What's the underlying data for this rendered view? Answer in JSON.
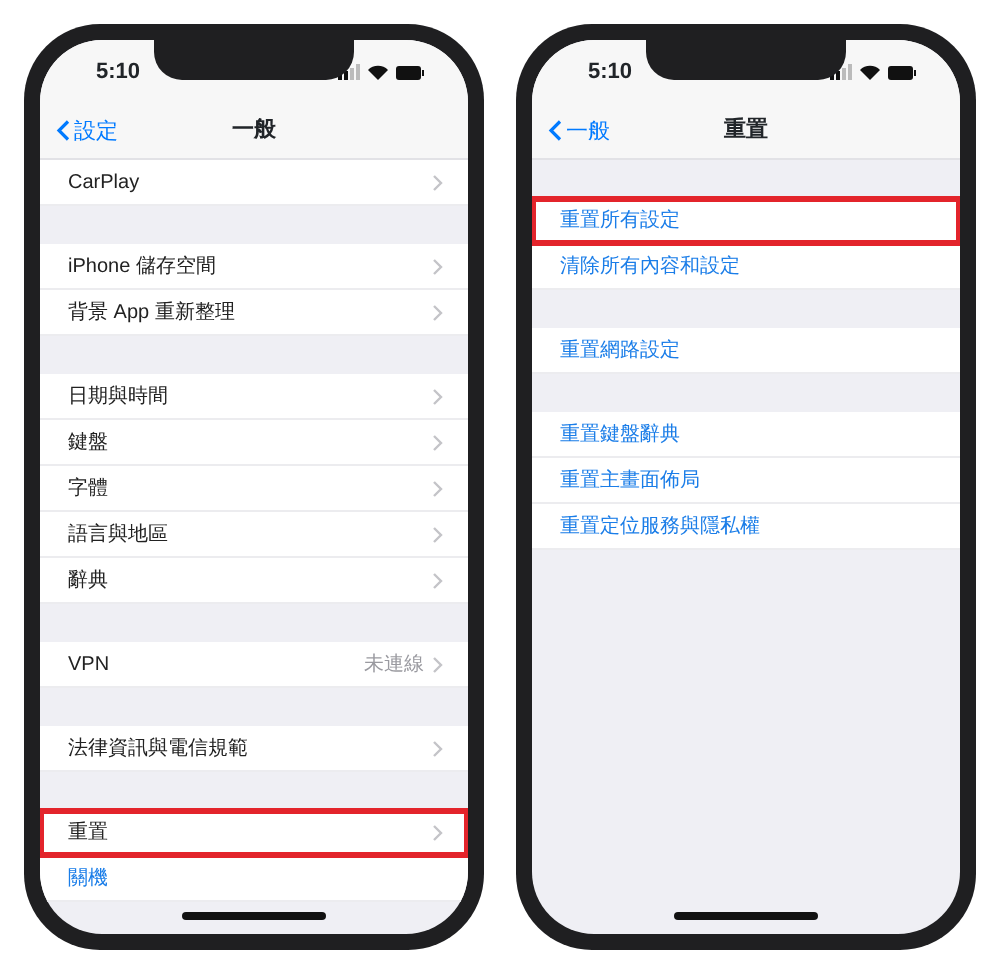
{
  "phones": [
    {
      "time": "5:10",
      "back": "設定",
      "title": "一般",
      "groups": [
        [
          {
            "label": "CarPlay",
            "kind": "nav",
            "highlighted": false
          }
        ],
        [
          {
            "label": "iPhone 儲存空間",
            "kind": "nav",
            "highlighted": false
          },
          {
            "label": "背景 App 重新整理",
            "kind": "nav",
            "highlighted": false
          }
        ],
        [
          {
            "label": "日期與時間",
            "kind": "nav",
            "highlighted": false
          },
          {
            "label": "鍵盤",
            "kind": "nav",
            "highlighted": false
          },
          {
            "label": "字體",
            "kind": "nav",
            "highlighted": false
          },
          {
            "label": "語言與地區",
            "kind": "nav",
            "highlighted": false
          },
          {
            "label": "辭典",
            "kind": "nav",
            "highlighted": false
          }
        ],
        [
          {
            "label": "VPN",
            "value": "未連線",
            "kind": "nav",
            "highlighted": false
          }
        ],
        [
          {
            "label": "法律資訊與電信規範",
            "kind": "nav",
            "highlighted": false
          }
        ],
        [
          {
            "label": "重置",
            "kind": "nav",
            "highlighted": true
          },
          {
            "label": "關機",
            "kind": "action",
            "highlighted": false
          }
        ]
      ]
    },
    {
      "time": "5:10",
      "back": "一般",
      "title": "重置",
      "groups": [
        [
          {
            "label": "重置所有設定",
            "kind": "action",
            "highlighted": true
          },
          {
            "label": "清除所有內容和設定",
            "kind": "action",
            "highlighted": false
          }
        ],
        [
          {
            "label": "重置網路設定",
            "kind": "action",
            "highlighted": false
          }
        ],
        [
          {
            "label": "重置鍵盤辭典",
            "kind": "action",
            "highlighted": false
          },
          {
            "label": "重置主畫面佈局",
            "kind": "action",
            "highlighted": false
          },
          {
            "label": "重置定位服務與隱私權",
            "kind": "action",
            "highlighted": false
          }
        ]
      ]
    }
  ]
}
